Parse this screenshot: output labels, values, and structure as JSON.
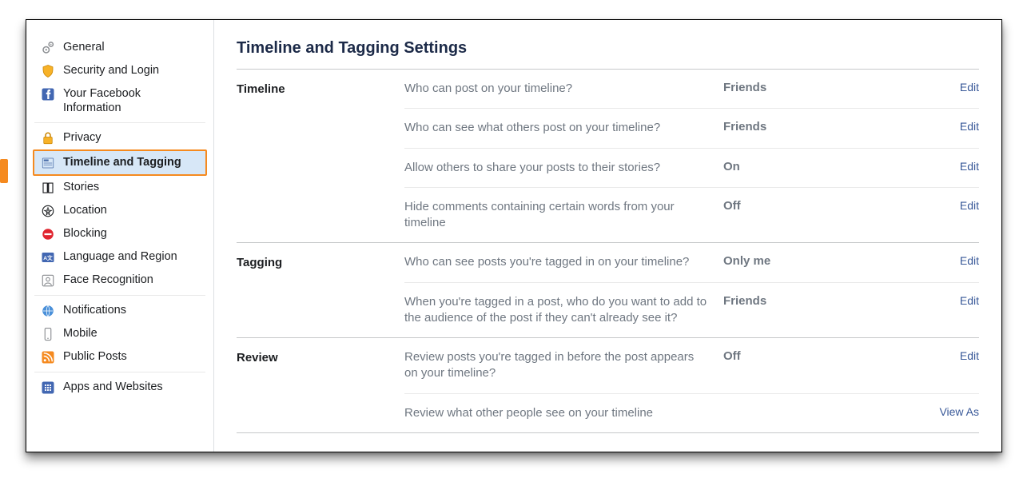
{
  "sidebar": {
    "groups": [
      {
        "items": [
          {
            "id": "general",
            "label": "General",
            "icon": "gear-icon"
          },
          {
            "id": "security",
            "label": "Security and Login",
            "icon": "shield-icon"
          },
          {
            "id": "your-info",
            "label": "Your Facebook Information",
            "icon": "fb-square-icon"
          }
        ]
      },
      {
        "items": [
          {
            "id": "privacy",
            "label": "Privacy",
            "icon": "lock-icon"
          },
          {
            "id": "timeline-tagging",
            "label": "Timeline and Tagging",
            "icon": "newspaper-icon",
            "selected": true
          },
          {
            "id": "stories",
            "label": "Stories",
            "icon": "book-icon"
          },
          {
            "id": "location",
            "label": "Location",
            "icon": "location-icon"
          },
          {
            "id": "blocking",
            "label": "Blocking",
            "icon": "block-icon"
          },
          {
            "id": "language",
            "label": "Language and Region",
            "icon": "language-icon"
          },
          {
            "id": "face",
            "label": "Face Recognition",
            "icon": "face-icon"
          }
        ]
      },
      {
        "items": [
          {
            "id": "notifications",
            "label": "Notifications",
            "icon": "globe-icon"
          },
          {
            "id": "mobile",
            "label": "Mobile",
            "icon": "mobile-icon"
          },
          {
            "id": "public-posts",
            "label": "Public Posts",
            "icon": "rss-icon"
          }
        ]
      },
      {
        "items": [
          {
            "id": "apps",
            "label": "Apps and Websites",
            "icon": "apps-icon"
          }
        ]
      }
    ]
  },
  "page": {
    "title": "Timeline and Tagging Settings",
    "edit_label": "Edit",
    "viewas_label": "View As",
    "sections": [
      {
        "title": "Timeline",
        "rows": [
          {
            "desc": "Who can post on your timeline?",
            "value": "Friends",
            "action": "edit"
          },
          {
            "desc": "Who can see what others post on your timeline?",
            "value": "Friends",
            "action": "edit"
          },
          {
            "desc": "Allow others to share your posts to their stories?",
            "value": "On",
            "action": "edit"
          },
          {
            "desc": "Hide comments containing certain words from your timeline",
            "value": "Off",
            "action": "edit"
          }
        ]
      },
      {
        "title": "Tagging",
        "rows": [
          {
            "desc": "Who can see posts you're tagged in on your timeline?",
            "value": "Only me",
            "action": "edit"
          },
          {
            "desc": "When you're tagged in a post, who do you want to add to the audience of the post if they can't already see it?",
            "value": "Friends",
            "action": "edit"
          }
        ]
      },
      {
        "title": "Review",
        "rows": [
          {
            "desc": "Review posts you're tagged in before the post appears on your timeline?",
            "value": "Off",
            "action": "edit"
          },
          {
            "desc": "Review what other people see on your timeline",
            "value": "",
            "action": "viewas"
          }
        ]
      }
    ]
  },
  "icons": {
    "gear-icon": "gear",
    "shield-icon": "shield",
    "fb-square-icon": "fb",
    "lock-icon": "lock",
    "newspaper-icon": "news",
    "book-icon": "book",
    "location-icon": "loc",
    "block-icon": "block",
    "language-icon": "lang",
    "face-icon": "face",
    "globe-icon": "globe",
    "mobile-icon": "mobile",
    "rss-icon": "rss",
    "apps-icon": "apps"
  }
}
